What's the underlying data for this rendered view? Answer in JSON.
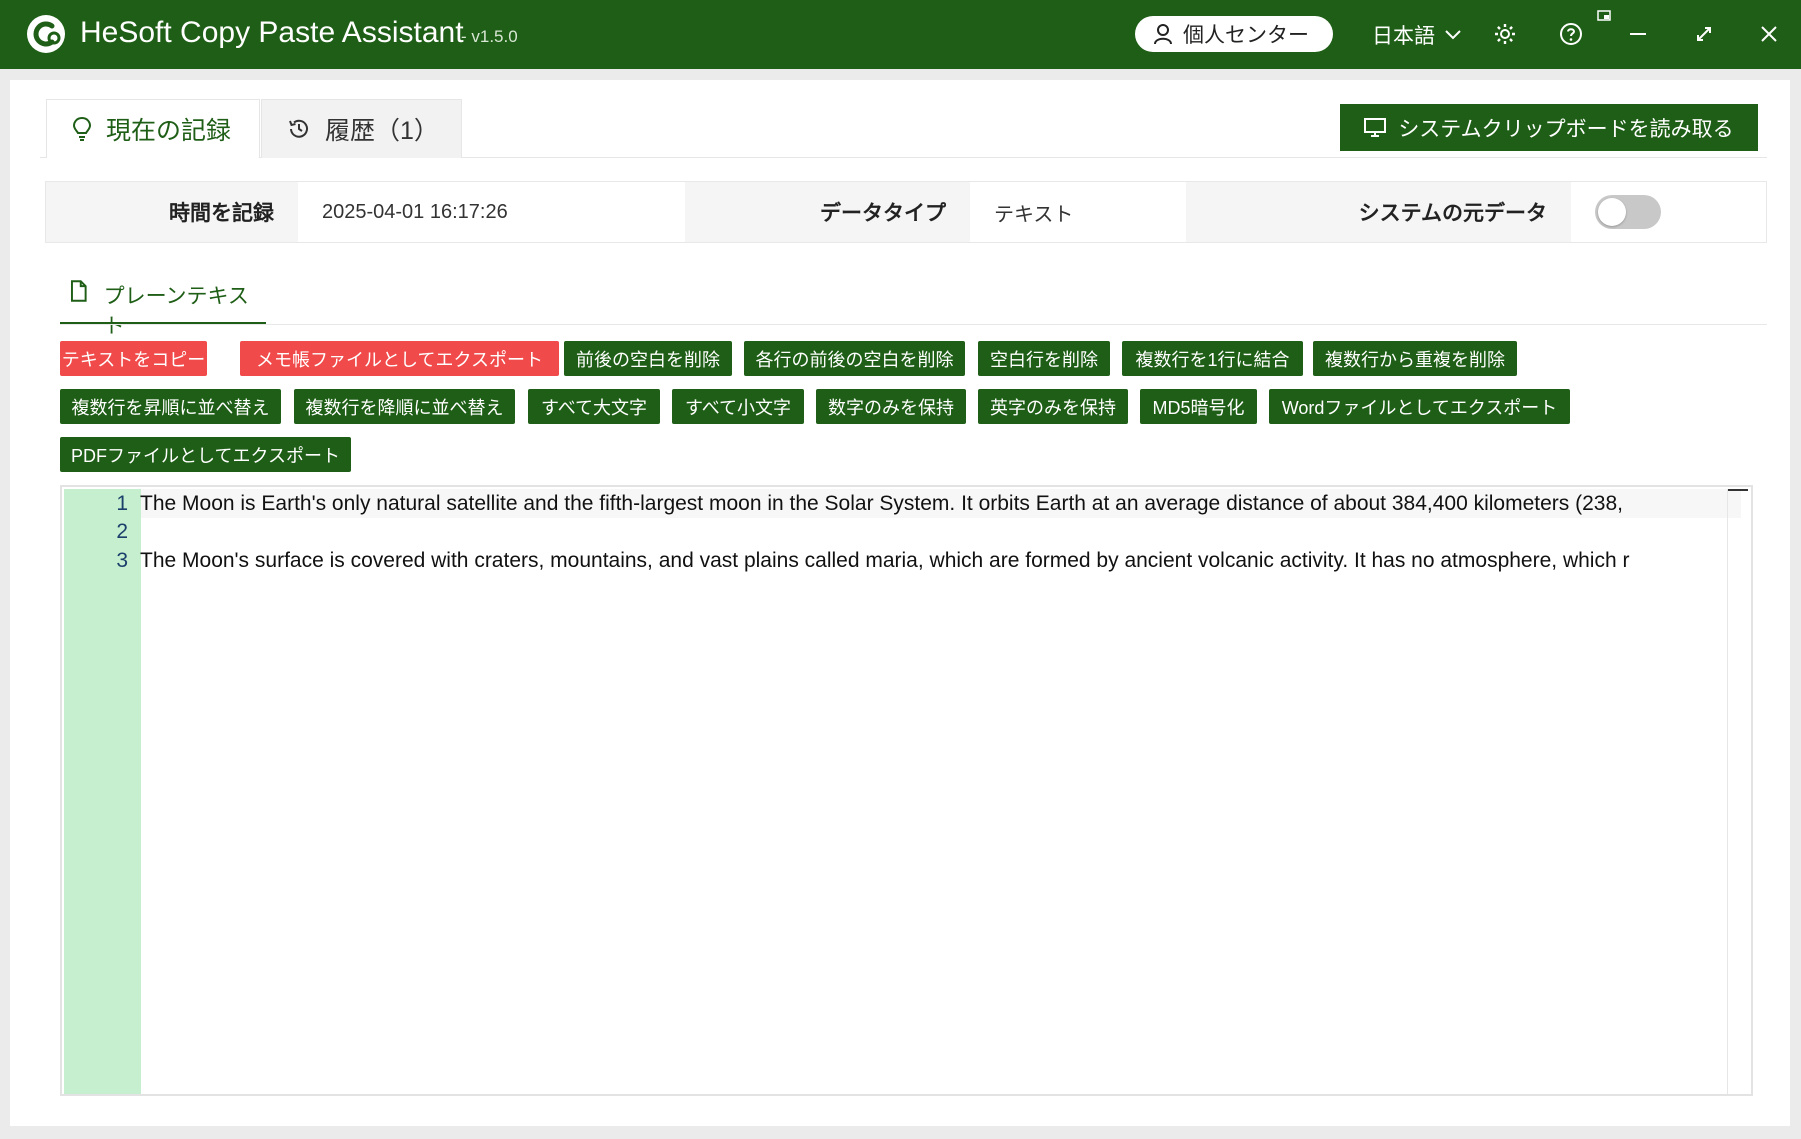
{
  "app": {
    "title": "HeSoft Copy Paste Assistant",
    "version": "- v1.5.0",
    "user_center": "個人センター",
    "language": "日本語"
  },
  "tabs": {
    "current": "現在の記録",
    "history": "履歴（1）"
  },
  "read_clipboard": "システムクリップボードを読み取る",
  "info": {
    "time_label": "時間を記録",
    "time_value": "2025-04-01 16:17:26",
    "type_label": "データタイプ",
    "type_value": "テキスト",
    "raw_label": "システムの元データ",
    "raw_enabled": false
  },
  "section": {
    "plain_text": "プレーンテキスト"
  },
  "actions": {
    "copy_text": "テキストをコピー",
    "export_notepad": "メモ帳ファイルとしてエクスポート",
    "trim_both": "前後の空白を削除",
    "trim_each_line": "各行の前後の空白を削除",
    "remove_blank_lines": "空白行を削除",
    "join_lines": "複数行を1行に結合",
    "dedupe_lines": "複数行から重複を削除",
    "sort_asc": "複数行を昇順に並べ替え",
    "sort_desc": "複数行を降順に並べ替え",
    "uppercase": "すべて大文字",
    "lowercase": "すべて小文字",
    "digits_only": "数字のみを保持",
    "letters_only": "英字のみを保持",
    "md5": "MD5暗号化",
    "export_word": "Wordファイルとしてエクスポート",
    "export_pdf": "PDFファイルとしてエクスポート"
  },
  "editor": {
    "line_numbers": [
      "1",
      "2",
      "3"
    ],
    "lines": [
      "The Moon is Earth's only natural satellite and the fifth-largest moon in the Solar System. It orbits Earth at an average distance of about 384,400 kilometers (238,",
      "",
      "The Moon's surface is covered with craters, mountains, and vast plains called maria, which are formed by ancient volcanic activity. It has no atmosphere, which r"
    ]
  },
  "colors": {
    "brand_green": "#1e5e16",
    "danger_red": "#f14a4a",
    "gutter_green": "#c6efcf"
  }
}
